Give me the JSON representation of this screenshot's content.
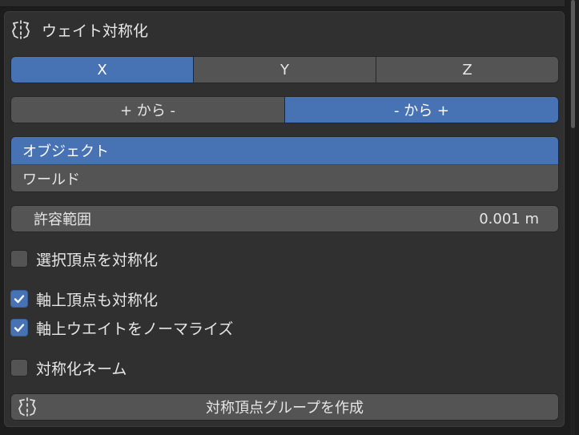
{
  "panel": {
    "title": "ウェイト対称化",
    "title_icon": "symmetry-icon"
  },
  "axis": {
    "options": [
      "X",
      "Y",
      "Z"
    ],
    "selected": "X"
  },
  "direction": {
    "options": [
      "+ から -",
      "- から +"
    ],
    "selected": "- から +"
  },
  "space": {
    "options": [
      "オブジェクト",
      "ワールド"
    ],
    "selected": "オブジェクト"
  },
  "tolerance": {
    "label": "許容範囲",
    "value": "0.001 m"
  },
  "checkboxes": {
    "symmetrize_selected": {
      "label": "選択頂点を対称化",
      "checked": false
    },
    "symmetrize_on_axis": {
      "label": "軸上頂点も対称化",
      "checked": true
    },
    "normalize_on_axis": {
      "label": "軸上ウエイトをノーマライズ",
      "checked": true
    },
    "symmetrize_names": {
      "label": "対称化ネーム",
      "checked": false
    }
  },
  "create_button": {
    "label": "対称頂点グループを作成",
    "icon": "symmetry-icon"
  },
  "colors": {
    "accent": "#4772b3",
    "widget": "#545454",
    "panel": "#303030",
    "background": "#1d1d1d"
  }
}
